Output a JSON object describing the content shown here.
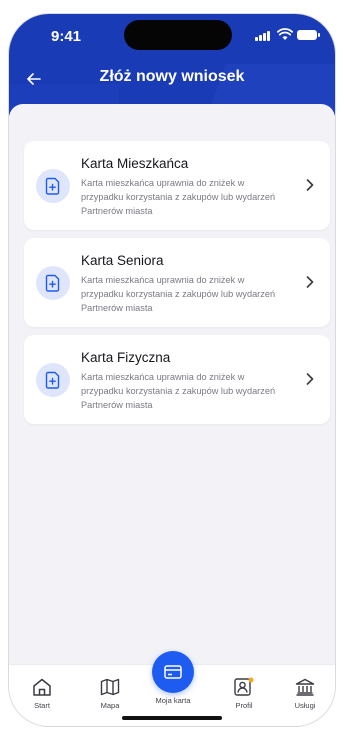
{
  "status": {
    "time": "9:41"
  },
  "nav": {
    "title": "Złóż nowy wniosek",
    "back_icon": "arrow-left-icon"
  },
  "cards": [
    {
      "title": "Karta Mieszkańca",
      "description": "Karta mieszkańca uprawnia do zniżek w przypadku korzystania z zakupów lub wydarzeń Partnerów miasta",
      "icon": "document-plus-icon"
    },
    {
      "title": "Karta Seniora",
      "description": "Karta mieszkańca uprawnia do zniżek w przypadku korzystania z zakupów lub wydarzeń Partnerów miasta",
      "icon": "document-plus-icon"
    },
    {
      "title": "Karta Fizyczna",
      "description": "Karta mieszkańca uprawnia do zniżek w przypadku korzystania z zakupów lub wydarzeń Partnerów miasta",
      "icon": "document-plus-icon"
    }
  ],
  "tabbar": {
    "start": "Start",
    "mapa": "Mapa",
    "moja_karta": "Moja karta",
    "profil": "Profil",
    "uslugi": "Usługi"
  },
  "colors": {
    "header": "#1a3bb6",
    "accent": "#1e5bf0",
    "icon_bg": "#dfe6fb"
  }
}
